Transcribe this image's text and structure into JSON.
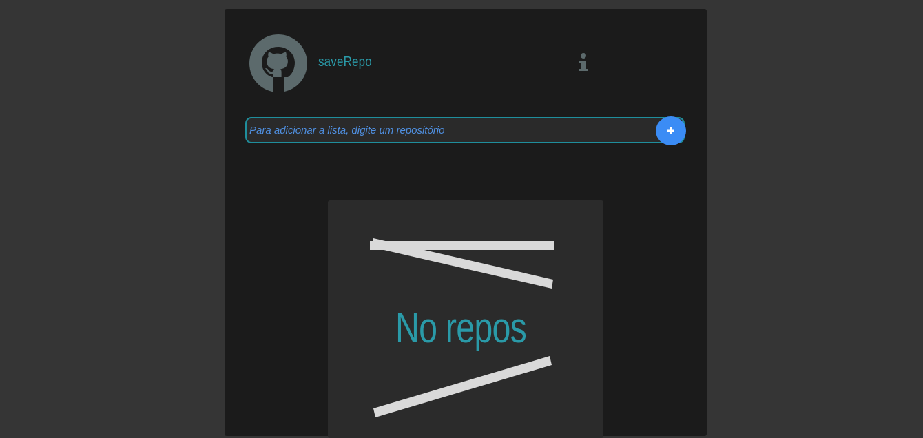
{
  "app": {
    "brand": "saveRepo",
    "logo_icon": "github-octocat-icon",
    "info_icon": "info-icon"
  },
  "search": {
    "placeholder": "Para adicionar a lista, digite um repositório",
    "value": "",
    "add_icon": "plus-icon"
  },
  "empty_state": {
    "message": "No repos",
    "illustration_icon": "empty-lines-illustration"
  },
  "colors": {
    "page_bg": "#353535",
    "panel_bg": "#1b1b1b",
    "card_bg": "#2b2b2b",
    "accent": "#2a9aa8",
    "button_blue": "#3b8cf5",
    "avatar_gray": "#5c6a6c"
  }
}
